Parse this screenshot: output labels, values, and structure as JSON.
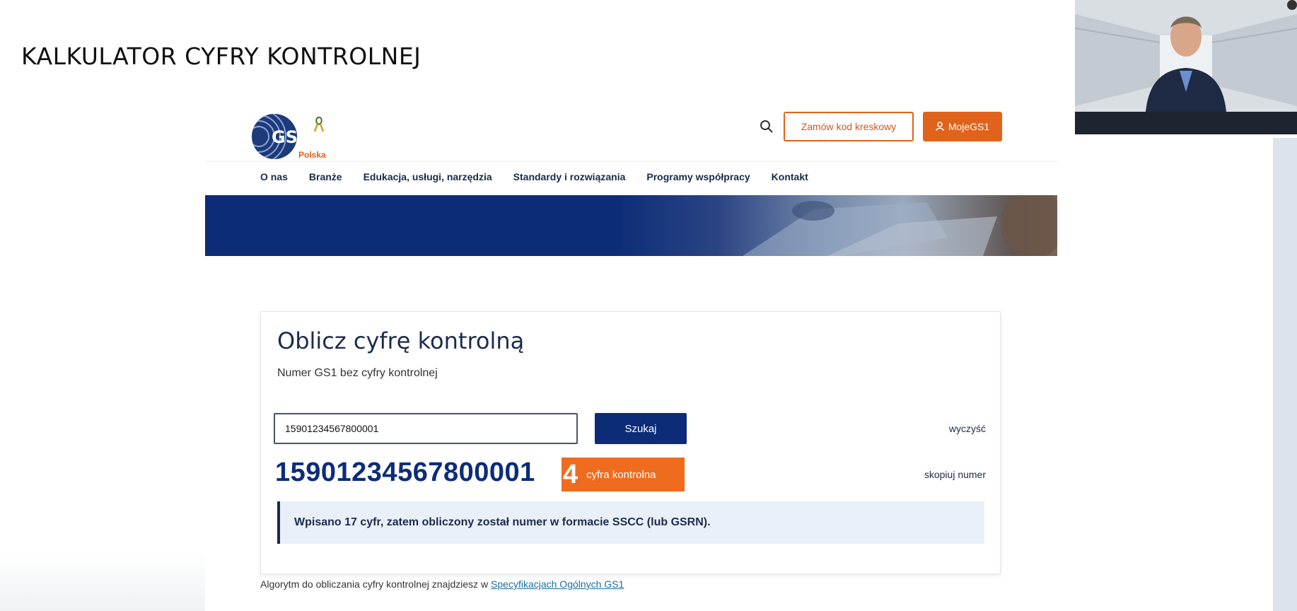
{
  "slide": {
    "title": "KALKULATOR CYFRY KONTROLNEJ"
  },
  "header": {
    "logo_text": "GS1",
    "logo_country": "Polska",
    "order_button": "Zamów kod kreskowy",
    "account_button": "MojeGS1"
  },
  "nav": {
    "items": [
      "O nas",
      "Branże",
      "Edukacja, usługi, narzędzia",
      "Standardy i rozwiązania",
      "Programy współpracy",
      "Kontakt"
    ]
  },
  "calculator": {
    "title": "Oblicz cyfrę kontrolną",
    "label": "Numer GS1 bez cyfry kontrolnej",
    "input_value": "15901234567800001",
    "search_button": "Szukaj",
    "clear_link": "wyczyść",
    "result_number": "15901234567800001",
    "check_digit": "4",
    "check_label": "cyfra kontrolna",
    "copy_link": "skopiuj numer",
    "info_message": "Wpisano 17 cyfr, zatem obliczony został numer w formacie SSCC (lub GSRN)."
  },
  "footer": {
    "note": "Algorytm do obliczania cyfry kontrolnej znajdziesz w",
    "link": "Specyfikacjach Ogólnych GS1"
  },
  "colors": {
    "brand_blue": "#0d2c78",
    "brand_orange": "#e0631b",
    "text_dark": "#1c2b4d"
  }
}
